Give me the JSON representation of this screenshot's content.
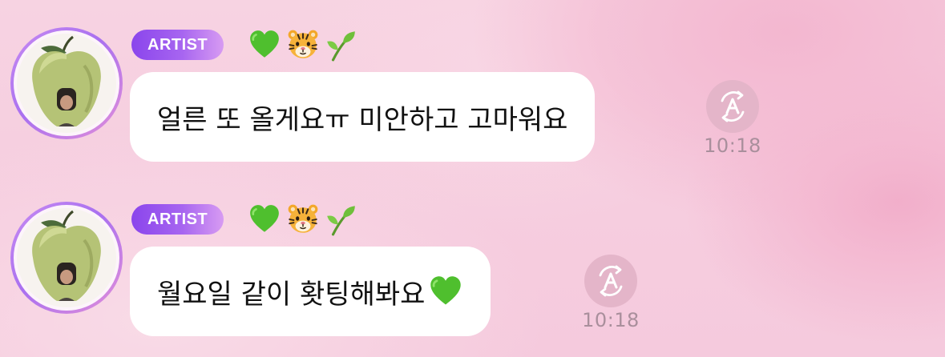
{
  "messages": [
    {
      "badge": "ARTIST",
      "emoji_icons": [
        "green-heart-icon",
        "tiger-face-icon",
        "seedling-icon"
      ],
      "text": "얼른 또 올게요ㅠ 미안하고 고마워요",
      "time": "10:18",
      "translate_icon": "translate-icon"
    },
    {
      "badge": "ARTIST",
      "emoji_icons": [
        "green-heart-icon",
        "tiger-face-icon",
        "seedling-icon"
      ],
      "text": "월요일 같이 홧팅해봐요",
      "trailing_emoji": "green-heart-icon",
      "time": "10:18",
      "translate_icon": "translate-icon"
    }
  ],
  "colors": {
    "badge_gradient_start": "#8a45ec",
    "badge_gradient_end": "#d79bf2",
    "bubble": "#ffffff",
    "time_text": "#a98f9c",
    "translate_bg": "#e4b5c9",
    "background": "#f6cfe0"
  }
}
